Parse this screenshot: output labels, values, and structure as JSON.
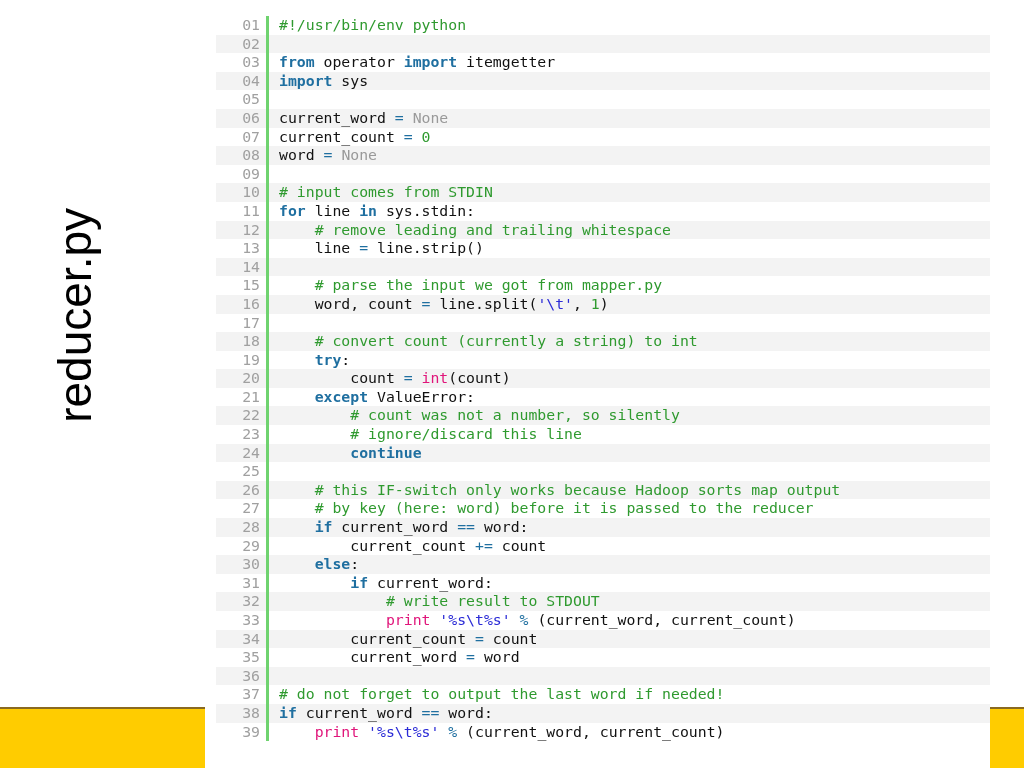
{
  "slide_title": "reducer.py",
  "code": {
    "lines": [
      {
        "number": "01",
        "tokens": [
          {
            "kind": "comment",
            "text": "#!/usr/bin/env python"
          }
        ]
      },
      {
        "number": "02"
      },
      {
        "number": "03",
        "tokens": [
          {
            "kind": "keyword",
            "text": "from"
          },
          {
            "kind": "text",
            "text": " operator "
          },
          {
            "kind": "keyword",
            "text": "import"
          },
          {
            "kind": "text",
            "text": " itemgetter"
          }
        ]
      },
      {
        "number": "04",
        "tokens": [
          {
            "kind": "keyword",
            "text": "import"
          },
          {
            "kind": "text",
            "text": " sys"
          }
        ]
      },
      {
        "number": "05"
      },
      {
        "number": "06",
        "tokens": [
          {
            "kind": "text",
            "text": "current_word "
          },
          {
            "kind": "operator",
            "text": "="
          },
          {
            "kind": "constant",
            "text": " None"
          }
        ]
      },
      {
        "number": "07",
        "tokens": [
          {
            "kind": "text",
            "text": "current_count "
          },
          {
            "kind": "operator",
            "text": "="
          },
          {
            "kind": "number",
            "text": " 0"
          }
        ]
      },
      {
        "number": "08",
        "tokens": [
          {
            "kind": "text",
            "text": "word "
          },
          {
            "kind": "operator",
            "text": "="
          },
          {
            "kind": "constant",
            "text": " None"
          }
        ]
      },
      {
        "number": "09"
      },
      {
        "number": "10",
        "tokens": [
          {
            "kind": "comment",
            "text": "# input comes from STDIN"
          }
        ]
      },
      {
        "number": "11",
        "tokens": [
          {
            "kind": "keyword",
            "text": "for"
          },
          {
            "kind": "text",
            "text": " line "
          },
          {
            "kind": "keyword",
            "text": "in"
          },
          {
            "kind": "text",
            "text": " sys.stdin:"
          }
        ]
      },
      {
        "number": "12",
        "tokens": [
          {
            "kind": "comment",
            "text": "    # remove leading and trailing whitespace"
          }
        ]
      },
      {
        "number": "13",
        "tokens": [
          {
            "kind": "text",
            "text": "    line "
          },
          {
            "kind": "operator",
            "text": "="
          },
          {
            "kind": "text",
            "text": " line.strip()"
          }
        ]
      },
      {
        "number": "14"
      },
      {
        "number": "15",
        "tokens": [
          {
            "kind": "comment",
            "text": "    # parse the input we got from mapper.py"
          }
        ]
      },
      {
        "number": "16",
        "tokens": [
          {
            "kind": "text",
            "text": "    word, count "
          },
          {
            "kind": "operator",
            "text": "="
          },
          {
            "kind": "text",
            "text": " line.split("
          },
          {
            "kind": "string",
            "text": "'\\t'"
          },
          {
            "kind": "text",
            "text": ", "
          },
          {
            "kind": "number",
            "text": "1"
          },
          {
            "kind": "text",
            "text": ")"
          }
        ]
      },
      {
        "number": "17"
      },
      {
        "number": "18",
        "tokens": [
          {
            "kind": "comment",
            "text": "    # convert count (currently a string) to int"
          }
        ]
      },
      {
        "number": "19",
        "tokens": [
          {
            "kind": "keyword",
            "text": "    try"
          },
          {
            "kind": "text",
            "text": ":"
          }
        ]
      },
      {
        "number": "20",
        "tokens": [
          {
            "kind": "text",
            "text": "        count "
          },
          {
            "kind": "operator",
            "text": "="
          },
          {
            "kind": "builtin",
            "text": " int"
          },
          {
            "kind": "text",
            "text": "(count)"
          }
        ]
      },
      {
        "number": "21",
        "tokens": [
          {
            "kind": "keyword",
            "text": "    except"
          },
          {
            "kind": "text",
            "text": " ValueError:"
          }
        ]
      },
      {
        "number": "22",
        "tokens": [
          {
            "kind": "comment",
            "text": "        # count was not a number, so silently"
          }
        ]
      },
      {
        "number": "23",
        "tokens": [
          {
            "kind": "comment",
            "text": "        # ignore/discard this line"
          }
        ]
      },
      {
        "number": "24",
        "tokens": [
          {
            "kind": "keyword",
            "text": "        continue"
          }
        ]
      },
      {
        "number": "25"
      },
      {
        "number": "26",
        "tokens": [
          {
            "kind": "comment",
            "text": "    # this IF-switch only works because Hadoop sorts map output"
          }
        ]
      },
      {
        "number": "27",
        "tokens": [
          {
            "kind": "comment",
            "text": "    # by key (here: word) before it is passed to the reducer"
          }
        ]
      },
      {
        "number": "28",
        "tokens": [
          {
            "kind": "keyword",
            "text": "    if"
          },
          {
            "kind": "text",
            "text": " current_word "
          },
          {
            "kind": "operator",
            "text": "=="
          },
          {
            "kind": "text",
            "text": " word:"
          }
        ]
      },
      {
        "number": "29",
        "tokens": [
          {
            "kind": "text",
            "text": "        current_count "
          },
          {
            "kind": "operator",
            "text": "+="
          },
          {
            "kind": "text",
            "text": " count"
          }
        ]
      },
      {
        "number": "30",
        "tokens": [
          {
            "kind": "keyword",
            "text": "    else"
          },
          {
            "kind": "text",
            "text": ":"
          }
        ]
      },
      {
        "number": "31",
        "tokens": [
          {
            "kind": "keyword",
            "text": "        if"
          },
          {
            "kind": "text",
            "text": " current_word:"
          }
        ]
      },
      {
        "number": "32",
        "tokens": [
          {
            "kind": "comment",
            "text": "            # write result to STDOUT"
          }
        ]
      },
      {
        "number": "33",
        "tokens": [
          {
            "kind": "builtin",
            "text": "            print"
          },
          {
            "kind": "string",
            "text": " '%s\\t%s'"
          },
          {
            "kind": "operator",
            "text": " %"
          },
          {
            "kind": "text",
            "text": " (current_word, current_count)"
          }
        ]
      },
      {
        "number": "34",
        "tokens": [
          {
            "kind": "text",
            "text": "        current_count "
          },
          {
            "kind": "operator",
            "text": "="
          },
          {
            "kind": "text",
            "text": " count"
          }
        ]
      },
      {
        "number": "35",
        "tokens": [
          {
            "kind": "text",
            "text": "        current_word "
          },
          {
            "kind": "operator",
            "text": "="
          },
          {
            "kind": "text",
            "text": " word"
          }
        ]
      },
      {
        "number": "36"
      },
      {
        "number": "37",
        "tokens": [
          {
            "kind": "comment",
            "text": "# do not forget to output the last word if needed!"
          }
        ]
      },
      {
        "number": "38",
        "tokens": [
          {
            "kind": "keyword",
            "text": "if"
          },
          {
            "kind": "text",
            "text": " current_word "
          },
          {
            "kind": "operator",
            "text": "=="
          },
          {
            "kind": "text",
            "text": " word:"
          }
        ]
      },
      {
        "number": "39",
        "tokens": [
          {
            "kind": "builtin",
            "text": "    print"
          },
          {
            "kind": "string",
            "text": " '%s\\t%s'"
          },
          {
            "kind": "operator",
            "text": " %"
          },
          {
            "kind": "text",
            "text": " (current_word, current_count)"
          }
        ]
      }
    ]
  }
}
